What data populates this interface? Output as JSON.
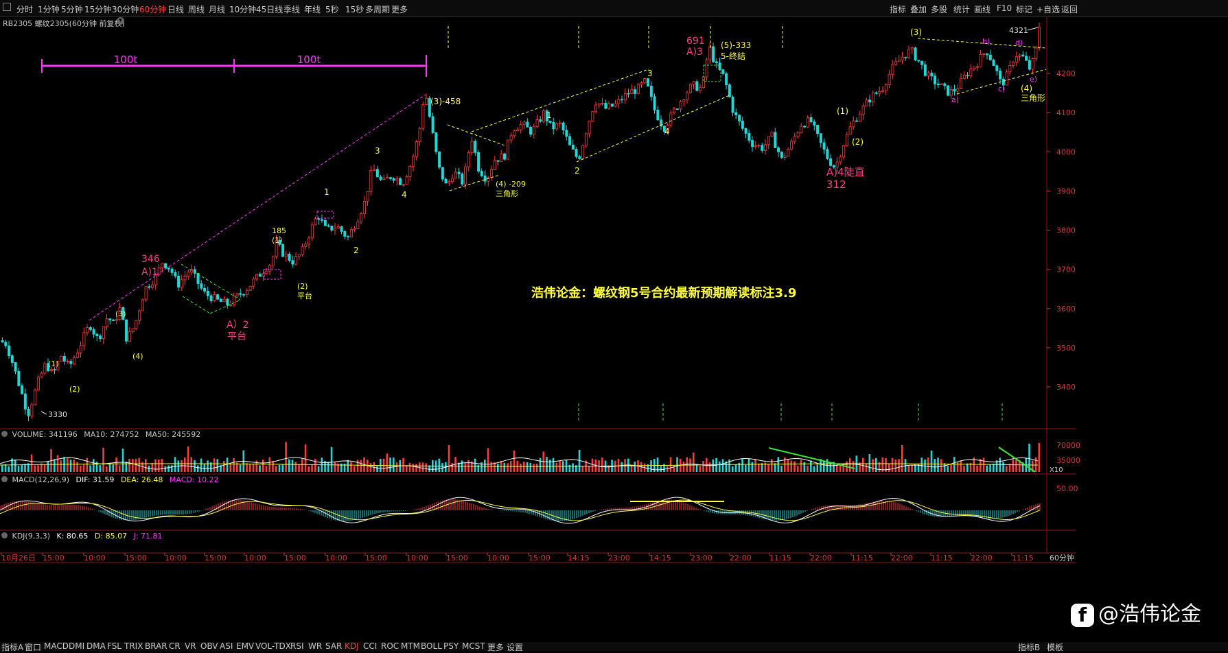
{
  "toolbar": {
    "periods": [
      "分时",
      "1分钟",
      "5分钟",
      "15分钟",
      "30分钟",
      "60分钟",
      "日线",
      "周线",
      "月线",
      "10分钟",
      "45日线",
      "季线",
      "年线",
      "5秒",
      "15秒",
      "多周期",
      "更多"
    ],
    "active_period": "60分钟",
    "right_tools": [
      "指标",
      "叠加",
      "多股",
      "统计",
      "画线",
      "F10",
      "标记",
      "+自选",
      "返回"
    ]
  },
  "chart_header": {
    "symbol": "RB2305 螺纹2305(60分钟 前复权)"
  },
  "volume_header": {
    "label": "VOLUME: 341196",
    "ma10": "MA10: 274752",
    "ma50": "MA50: 245592"
  },
  "macd_header": {
    "label": "MACD(12,26,9)",
    "dif": "DIF: 31.59",
    "dea": "DEA: 26.48",
    "macd": "MACD: 10.22"
  },
  "kdj_header": {
    "label": "KDJ(9,3,3)",
    "k": "K: 80.65",
    "d": "D: 85.07",
    "j": "J: 71.81"
  },
  "price_axis": {
    "ticks": [
      "4200",
      "4100",
      "4000",
      "3900",
      "3800",
      "3700",
      "3600",
      "3500",
      "3400"
    ]
  },
  "volume_axis": {
    "ticks": [
      "70000",
      "35000"
    ],
    "unit": "X10"
  },
  "macd_axis": {
    "ticks": [
      "50.00"
    ]
  },
  "time_axis": {
    "ticks": [
      "10月26日",
      "15:00",
      "10:00",
      "15:00",
      "10:00",
      "15:00",
      "10:00",
      "15:00",
      "10:00",
      "15:00",
      "10:00",
      "15:00",
      "10:00",
      "15:00",
      "14:15",
      "23:00",
      "14:15",
      "23:00",
      "22:00",
      "11:15",
      "22:00",
      "11:15",
      "22:00",
      "11:15",
      "22:00",
      "11:15"
    ],
    "period_label": "60分钟"
  },
  "bottom_bar": {
    "tabs": [
      "指标A",
      "窗口",
      "MACD",
      "DMI",
      "DMA",
      "FSL",
      "TRIX",
      "BRAR",
      "CR",
      "VR",
      "OBV",
      "ASI",
      "EMV",
      "VOL-TDX",
      "RSI",
      "WR",
      "SAR",
      "KDJ",
      "CCI",
      "ROC",
      "MTM",
      "BOLL",
      "PSY",
      "MCST",
      "更多",
      "设置"
    ],
    "active_tab": "KDJ",
    "right": [
      "指标B",
      "模板"
    ]
  },
  "annotations": {
    "measure_1": "100t",
    "measure_2": "100t",
    "low": "3330",
    "w1": "(1)",
    "w2": "(2)",
    "w3": "(3)",
    "w4": "(4)",
    "a1_num": "346",
    "a1": "A)1",
    "a2": "A）2",
    "a2_sub": "平台",
    "n185": "185",
    "n1_2": "(1)",
    "n2_2": "(2)",
    "pingtai": "平台",
    "i1": "1",
    "i2": "2",
    "i3": "3",
    "i4": "4",
    "w3_458": "(3)-458",
    "w4_209": "(4) -209",
    "sanjiao1": "三角形",
    "j1": "1",
    "j2": "2",
    "j3": "3",
    "j4": "4",
    "n691": "691",
    "a3": "A)3",
    "w5": "(5)-333",
    "w5_end": "5-终结",
    "a4": "A)4陡直",
    "n312": "312",
    "w1b": "(1)",
    "w2b": "(2)",
    "w3b": "(3)",
    "sa": "a)",
    "sb": "b)",
    "sc": "c)",
    "sd": "d)",
    "se": "e)",
    "w4b": "(4)",
    "sanjiao2": "三角形",
    "n4321": "4321",
    "title": "浩伟论金：螺纹钢5号合约最新预期解读标注3.9"
  },
  "watermark": {
    "text": "@浩伟论金"
  },
  "colors": {
    "up": "#ff3b3b",
    "down": "#1fd8d8",
    "label": "#ffff3b",
    "magenta": "#ff35ff",
    "pink": "#ff3a8a"
  },
  "chart_data": {
    "type": "candlestick",
    "title": "浩伟论金：螺纹钢5号合约最新预期解读标注3.9",
    "symbol": "RB2305",
    "period": "60分钟",
    "ylim": [
      3300,
      4330
    ],
    "price_path": [
      [
        0,
        3520
      ],
      [
        12,
        3510
      ],
      [
        20,
        3470
      ],
      [
        32,
        3400
      ],
      [
        44,
        3330
      ],
      [
        58,
        3410
      ],
      [
        70,
        3460
      ],
      [
        80,
        3430
      ],
      [
        92,
        3480
      ],
      [
        104,
        3450
      ],
      [
        118,
        3500
      ],
      [
        134,
        3560
      ],
      [
        146,
        3520
      ],
      [
        160,
        3580
      ],
      [
        168,
        3560
      ],
      [
        178,
        3600
      ],
      [
        188,
        3520
      ],
      [
        200,
        3560
      ],
      [
        214,
        3650
      ],
      [
        230,
        3680
      ],
      [
        240,
        3720
      ],
      [
        252,
        3700
      ],
      [
        262,
        3660
      ],
      [
        280,
        3700
      ],
      [
        300,
        3640
      ],
      [
        320,
        3620
      ],
      [
        336,
        3610
      ],
      [
        348,
        3630
      ],
      [
        362,
        3650
      ],
      [
        378,
        3680
      ],
      [
        388,
        3700
      ],
      [
        400,
        3720
      ],
      [
        404,
        3770
      ],
      [
        416,
        3740
      ],
      [
        430,
        3720
      ],
      [
        442,
        3740
      ],
      [
        456,
        3800
      ],
      [
        466,
        3840
      ],
      [
        478,
        3800
      ],
      [
        494,
        3810
      ],
      [
        510,
        3780
      ],
      [
        524,
        3830
      ],
      [
        534,
        3870
      ],
      [
        546,
        3960
      ],
      [
        560,
        3920
      ],
      [
        574,
        3940
      ],
      [
        590,
        3920
      ],
      [
        604,
        3980
      ],
      [
        614,
        4050
      ],
      [
        622,
        4160
      ],
      [
        632,
        4060
      ],
      [
        642,
        3960
      ],
      [
        654,
        3910
      ],
      [
        664,
        3950
      ],
      [
        678,
        3920
      ],
      [
        690,
        4040
      ],
      [
        700,
        3960
      ],
      [
        712,
        3930
      ],
      [
        724,
        3980
      ],
      [
        738,
        3990
      ],
      [
        750,
        4060
      ],
      [
        764,
        4070
      ],
      [
        778,
        4050
      ],
      [
        796,
        4100
      ],
      [
        806,
        4060
      ],
      [
        820,
        4070
      ],
      [
        834,
        4010
      ],
      [
        846,
        3980
      ],
      [
        858,
        4060
      ],
      [
        870,
        4130
      ],
      [
        886,
        4110
      ],
      [
        900,
        4120
      ],
      [
        918,
        4150
      ],
      [
        932,
        4160
      ],
      [
        944,
        4180
      ],
      [
        956,
        4110
      ],
      [
        970,
        4060
      ],
      [
        984,
        4100
      ],
      [
        998,
        4140
      ],
      [
        1012,
        4170
      ],
      [
        1026,
        4160
      ],
      [
        1036,
        4270
      ],
      [
        1046,
        4220
      ],
      [
        1058,
        4190
      ],
      [
        1072,
        4100
      ],
      [
        1088,
        4050
      ],
      [
        1100,
        4020
      ],
      [
        1114,
        4010
      ],
      [
        1128,
        4040
      ],
      [
        1142,
        3980
      ],
      [
        1156,
        4020
      ],
      [
        1170,
        4070
      ],
      [
        1184,
        4080
      ],
      [
        1196,
        4030
      ],
      [
        1210,
        3980
      ],
      [
        1220,
        3960
      ],
      [
        1232,
        4020
      ],
      [
        1244,
        4070
      ],
      [
        1256,
        4100
      ],
      [
        1272,
        4140
      ],
      [
        1288,
        4160
      ],
      [
        1302,
        4210
      ],
      [
        1316,
        4240
      ],
      [
        1330,
        4260
      ],
      [
        1342,
        4230
      ],
      [
        1356,
        4190
      ],
      [
        1372,
        4170
      ],
      [
        1386,
        4150
      ],
      [
        1396,
        4160
      ],
      [
        1412,
        4200
      ],
      [
        1428,
        4230
      ],
      [
        1440,
        4260
      ],
      [
        1452,
        4220
      ],
      [
        1462,
        4170
      ],
      [
        1472,
        4200
      ],
      [
        1482,
        4250
      ],
      [
        1494,
        4240
      ],
      [
        1504,
        4210
      ],
      [
        1512,
        4250
      ],
      [
        1516,
        4321
      ]
    ]
  }
}
